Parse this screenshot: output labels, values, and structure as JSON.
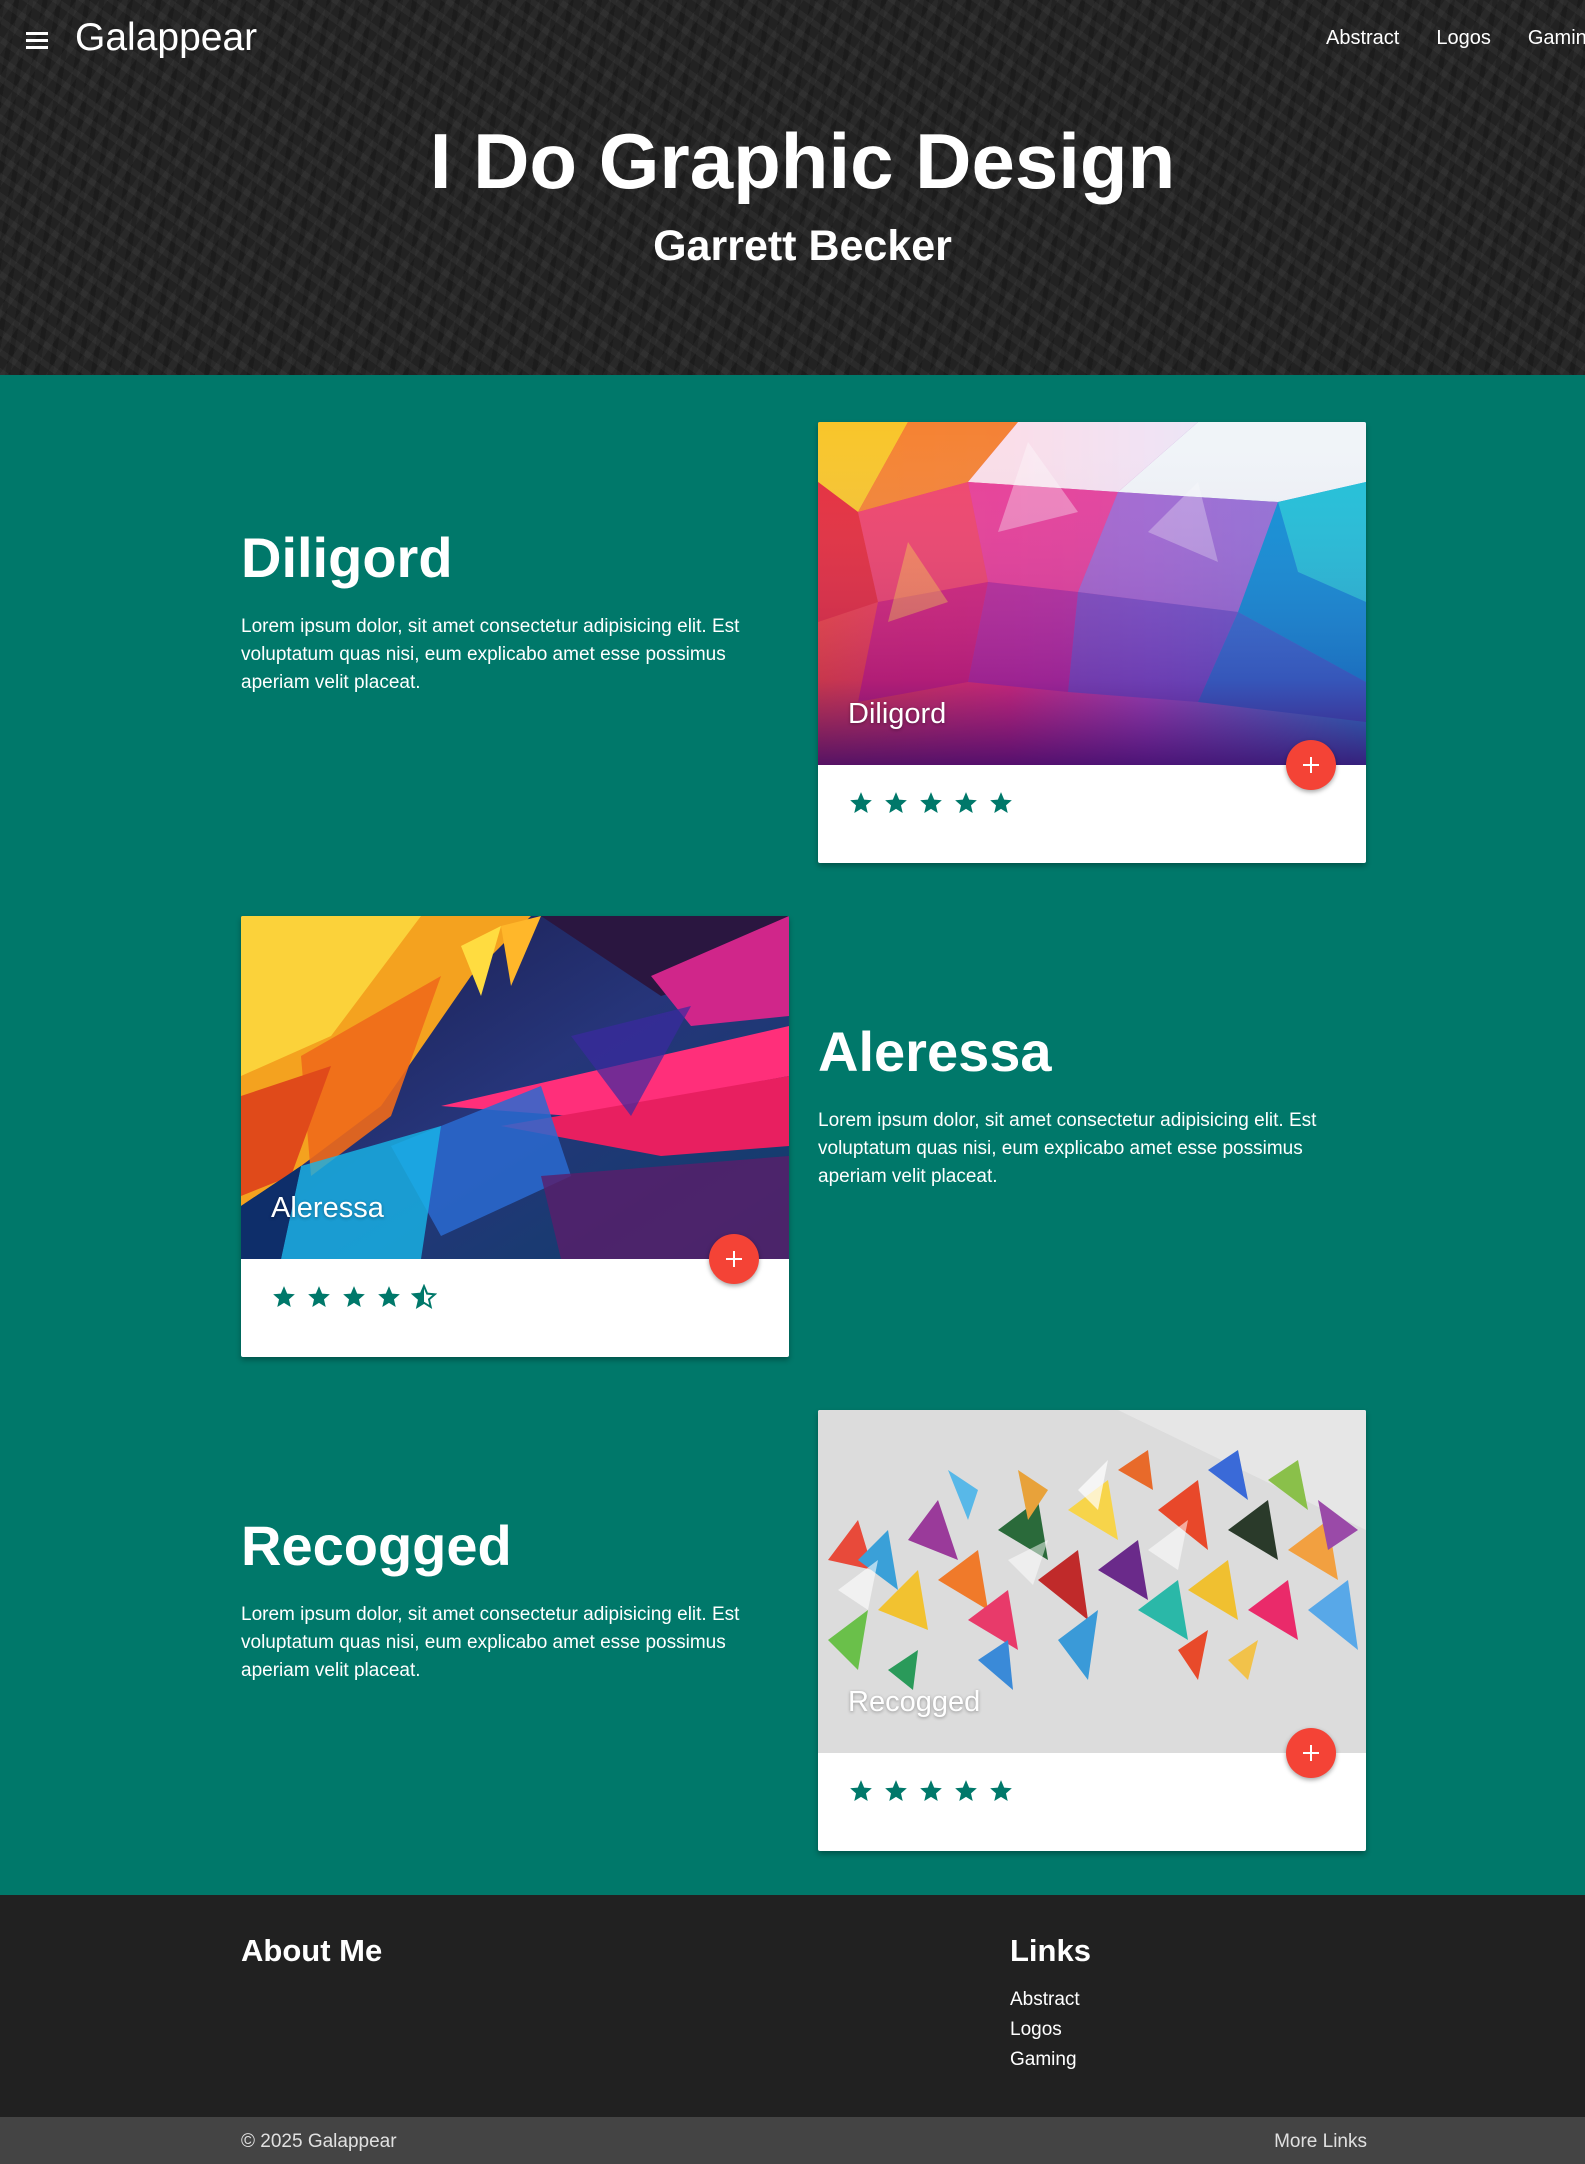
{
  "nav": {
    "brand": "Galappear",
    "links": [
      "Abstract",
      "Logos",
      "Gaming"
    ]
  },
  "hero": {
    "title": "I Do Graphic Design",
    "subtitle": "Garrett Becker"
  },
  "sections": [
    {
      "title": "Diligord",
      "description": "Lorem ipsum dolor, sit amet consectetur adipisicing elit. Est voluptatum quas nisi, eum explicabo amet esse possimus aperiam velit placeat.",
      "card_caption": "Diligord",
      "rating": 5
    },
    {
      "title": "Aleressa",
      "description": "Lorem ipsum dolor, sit amet consectetur adipisicing elit. Est voluptatum quas nisi, eum explicabo amet esse possimus aperiam velit placeat.",
      "card_caption": "Aleressa",
      "rating": 4.5
    },
    {
      "title": "Recogged",
      "description": "Lorem ipsum dolor, sit amet consectetur adipisicing elit. Est voluptatum quas nisi, eum explicabo amet esse possimus aperiam velit placeat.",
      "card_caption": "Recogged",
      "rating": 5
    }
  ],
  "footer": {
    "about_title": "About Me",
    "links_title": "Links",
    "links": [
      "Abstract",
      "Logos",
      "Gaming"
    ],
    "copyright": "© 2025 Galappear",
    "more_links": "More Links"
  },
  "colors": {
    "primary": "#00786a",
    "accent": "#f44336",
    "header_bg": "#222222",
    "footer_bg": "#212121",
    "star": "#00786a"
  },
  "icons": {
    "menu": "menu-icon",
    "add": "add-icon",
    "star": "star-icon",
    "star_half": "star-half-icon"
  }
}
